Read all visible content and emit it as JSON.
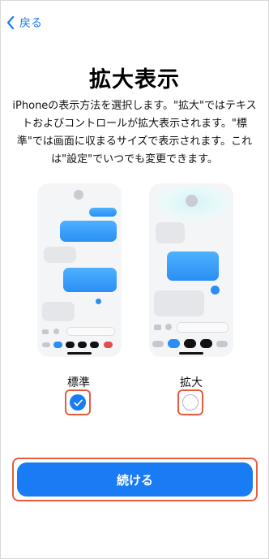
{
  "nav": {
    "back_label": "戻る"
  },
  "page": {
    "title": "拡大表示",
    "description": "iPhoneの表示方法を選択します。\"拡大\"ではテキストおよびコントロールが拡大表示されます。\"標準\"では画面に収まるサイズで表示されます。これは\"設定\"でいつでも変更できます。"
  },
  "options": [
    {
      "label": "標準",
      "selected": true
    },
    {
      "label": "拡大",
      "selected": false
    }
  ],
  "cta": {
    "label": "続ける"
  },
  "colors": {
    "accent": "#1a7cf4",
    "highlight": "#e85c3e"
  }
}
